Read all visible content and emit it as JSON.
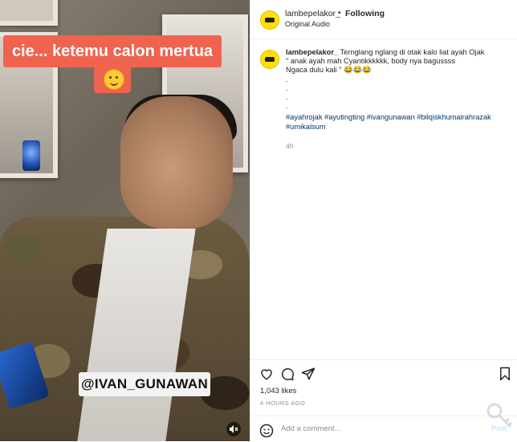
{
  "video": {
    "caption": "cie... ketemu calon mertua",
    "tag": "@IVAN_GUNAWAN",
    "mute_icon": "speaker-muted-icon"
  },
  "header": {
    "username": "lambepelakor_",
    "separator": "•",
    "follow_label": "Following",
    "audio_label": "Original Audio"
  },
  "post": {
    "username": "lambepelakor_",
    "caption_lines": [
      "Ternglang nglang di otak kalo liat ayah Ojak",
      "\" anak ayah mah Cyantikkkkkk, body nya bagussss",
      "Ngaca dulu kali \" 😂😂😂",
      ".",
      ".",
      ".",
      "."
    ],
    "hashtags": "#ayahrojak #ayutingting #ivangunawan #bilqiskhumairahrazak #umikalsum",
    "time": "4h"
  },
  "actions": {
    "like_icon": "heart-icon",
    "comment_icon": "comment-icon",
    "share_icon": "share-icon",
    "save_icon": "bookmark-icon"
  },
  "stats": {
    "likes": "1,043 likes",
    "ago": "4 HOURS AGO"
  },
  "comment_box": {
    "placeholder": "Add a comment...",
    "post_label": "Post",
    "emoji_icon": "smiley-icon"
  }
}
